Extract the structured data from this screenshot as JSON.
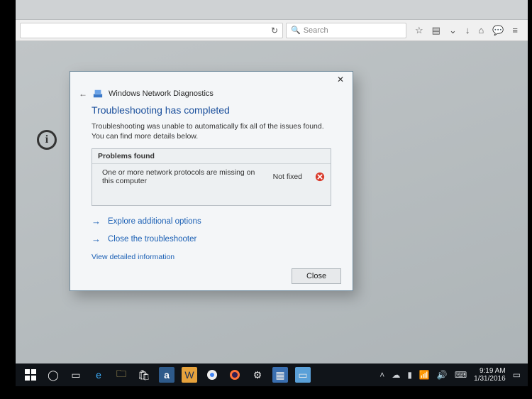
{
  "browser": {
    "search_placeholder": "Search",
    "icons": [
      "star-icon",
      "reader-icon",
      "pocket-icon",
      "download-icon",
      "home-icon",
      "chat-icon",
      "menu-icon"
    ]
  },
  "dialog": {
    "title": "Windows Network Diagnostics",
    "heading": "Troubleshooting has completed",
    "subtext": "Troubleshooting was unable to automatically fix all of the issues found. You can find more details below.",
    "problems_header": "Problems found",
    "problems": [
      {
        "text": "One or more network protocols are missing on this computer",
        "status": "Not fixed"
      }
    ],
    "explore_label": "Explore additional options",
    "close_ts_label": "Close the troubleshooter",
    "detailed_label": "View detailed information",
    "close_button": "Close"
  },
  "taskbar": {
    "time": "9:19 AM",
    "date": "1/31/2016"
  }
}
